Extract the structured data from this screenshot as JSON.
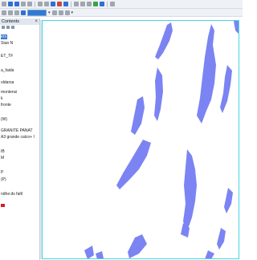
{
  "toc": {
    "title": "Contents",
    "close_glyph": "×",
    "items": [
      "ers",
      "Stan N",
      "",
      "ET_TF",
      "",
      "a_faida",
      "",
      "oldarsa",
      "",
      "montensi",
      "k",
      "fronte",
      "",
      "(W)",
      "",
      "GRANITE PANAT",
      "A3 grande calco+ I",
      "",
      "IB",
      "M",
      "",
      "P",
      "(P)",
      "",
      "ndhe:ds faltl"
    ],
    "legend_swatch_color": "#d61f26"
  },
  "map": {
    "border_color": "#44d7e8",
    "feature_color": "#7b84f2"
  }
}
